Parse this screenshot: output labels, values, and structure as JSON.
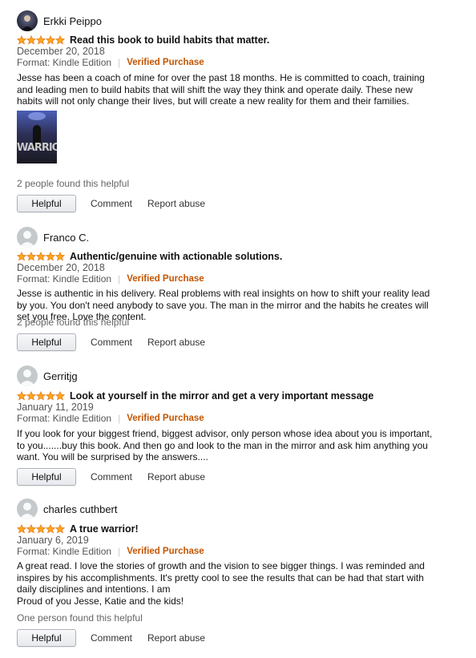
{
  "reviews": [
    {
      "reviewer": "Erkki Peippo",
      "avatar": "reviewer-photo",
      "rating": 5,
      "title": "Read this book to build habits that matter.",
      "date": "December 20, 2018",
      "format": "Format: Kindle Edition",
      "verified": "Verified Purchase",
      "body": "Jesse has been a coach of mine for over the past 18 months. He is committed to coach, training and leading men to build habits that will shift the way they think and operate daily. These new habits will not only change their lives, but will create a new reality for them and their families.",
      "image_text": "WARRIOR",
      "helpful_count": "2 people found this helpful",
      "helpful_label": "Helpful",
      "comment_label": "Comment",
      "report_label": "Report abuse"
    },
    {
      "reviewer": "Franco C.",
      "avatar": "default-avatar",
      "rating": 5,
      "title": "Authentic/genuine with actionable solutions.",
      "date": "December 20, 2018",
      "format": "Format: Kindle Edition",
      "verified": "Verified Purchase",
      "body": "Jesse is authentic in his delivery. Real problems with real insights on how to shift your reality lead by you. You don't need anybody to save you. The man in the mirror and the habits he creates will set you free. Love the content.",
      "helpful_count": "2 people found this helpful",
      "helpful_label": "Helpful",
      "comment_label": "Comment",
      "report_label": "Report abuse"
    },
    {
      "reviewer": "Gerritjg",
      "avatar": "default-avatar",
      "rating": 5,
      "title": "Look at yourself in the mirror and get a very important message",
      "date": "January 11, 2019",
      "format": "Format: Kindle Edition",
      "verified": "Verified Purchase",
      "body": "If you look for your biggest friend, biggest advisor, only person whose idea about you is important, to you.......buy this book. And then go and look to the man in the mirror and ask him anything you want. You will be surprised by the answers....",
      "helpful_label": "Helpful",
      "comment_label": "Comment",
      "report_label": "Report abuse"
    },
    {
      "reviewer": "charles cuthbert",
      "avatar": "default-avatar",
      "rating": 5,
      "title": "A true warrior!",
      "date": "January 6, 2019",
      "format": "Format: Kindle Edition",
      "verified": "Verified Purchase",
      "body": "A great read. I love the stories of growth and the vision to see bigger things. I was reminded and inspires by his accomplishments. It's pretty cool to see the results that can be had that start with daily disciplines and intentions. I am\nProud of you Jesse, Katie and the kids!",
      "helpful_count": "One person found this helpful",
      "helpful_label": "Helpful",
      "comment_label": "Comment",
      "report_label": "Report abuse"
    }
  ],
  "colors": {
    "star": "#ffa41c",
    "star_outline": "#de7921",
    "verified": "#c45500",
    "muted": "#555555"
  }
}
